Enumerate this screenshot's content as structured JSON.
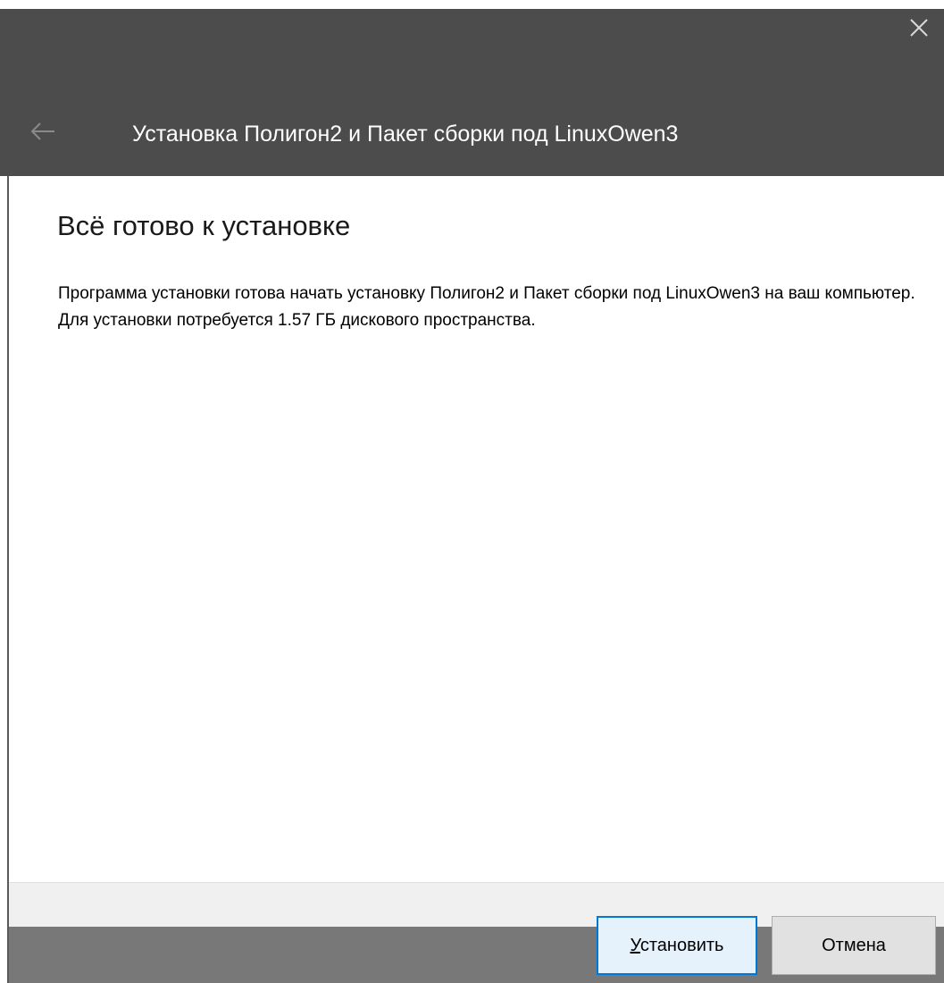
{
  "window": {
    "title": "Установка Полигон2 и Пакет сборки под LinuxOwen3",
    "close_icon": "close-icon",
    "back_icon": "back-arrow-icon"
  },
  "page": {
    "heading": "Всё готово к установке",
    "description": "Программа установки готова начать установку Полигон2 и Пакет сборки под LinuxOwen3 на ваш компьютер. Для установки потребуется 1.57 ГБ дискового пространства."
  },
  "buttons": {
    "install_label_mnemonic": "У",
    "install_label_rest": "становить",
    "cancel_label": "Отмена"
  },
  "colors": {
    "header_bg": "#4c4c4c",
    "accent": "#0078d7"
  }
}
